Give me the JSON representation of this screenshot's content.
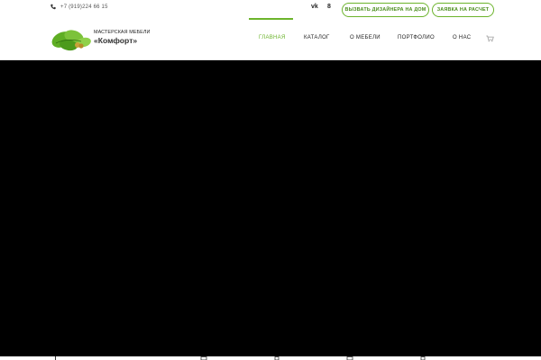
{
  "topbar": {
    "phone": "+7 (919)224 66 15",
    "phone_icon": "phone-icon",
    "social": {
      "vk": "vk",
      "ok": "8"
    },
    "buttons": {
      "designer": "ВЫЗВАТЬ ДИЗАЙНЕРА НА ДОМ",
      "request": "ЗАЯВКА НА РАСЧЕТ"
    }
  },
  "logo": {
    "line1": "МАСТЕРСКАЯ МЕБЕЛИ",
    "line2": "«Комфорт»",
    "icon": "oak-leaf-icon"
  },
  "nav": {
    "items": [
      {
        "label": "ГЛАВНАЯ",
        "active": true
      },
      {
        "label": "КАТАЛОГ",
        "active": false
      },
      {
        "label": "О МЕБЕЛИ",
        "active": false
      },
      {
        "label": "ПОРТФОЛИО",
        "active": false
      },
      {
        "label": "О НАС",
        "active": false
      }
    ],
    "cart_icon": "cart-icon"
  },
  "colors": {
    "accent": "#6cb42c",
    "hero_bg": "#000000",
    "text": "#222222"
  }
}
